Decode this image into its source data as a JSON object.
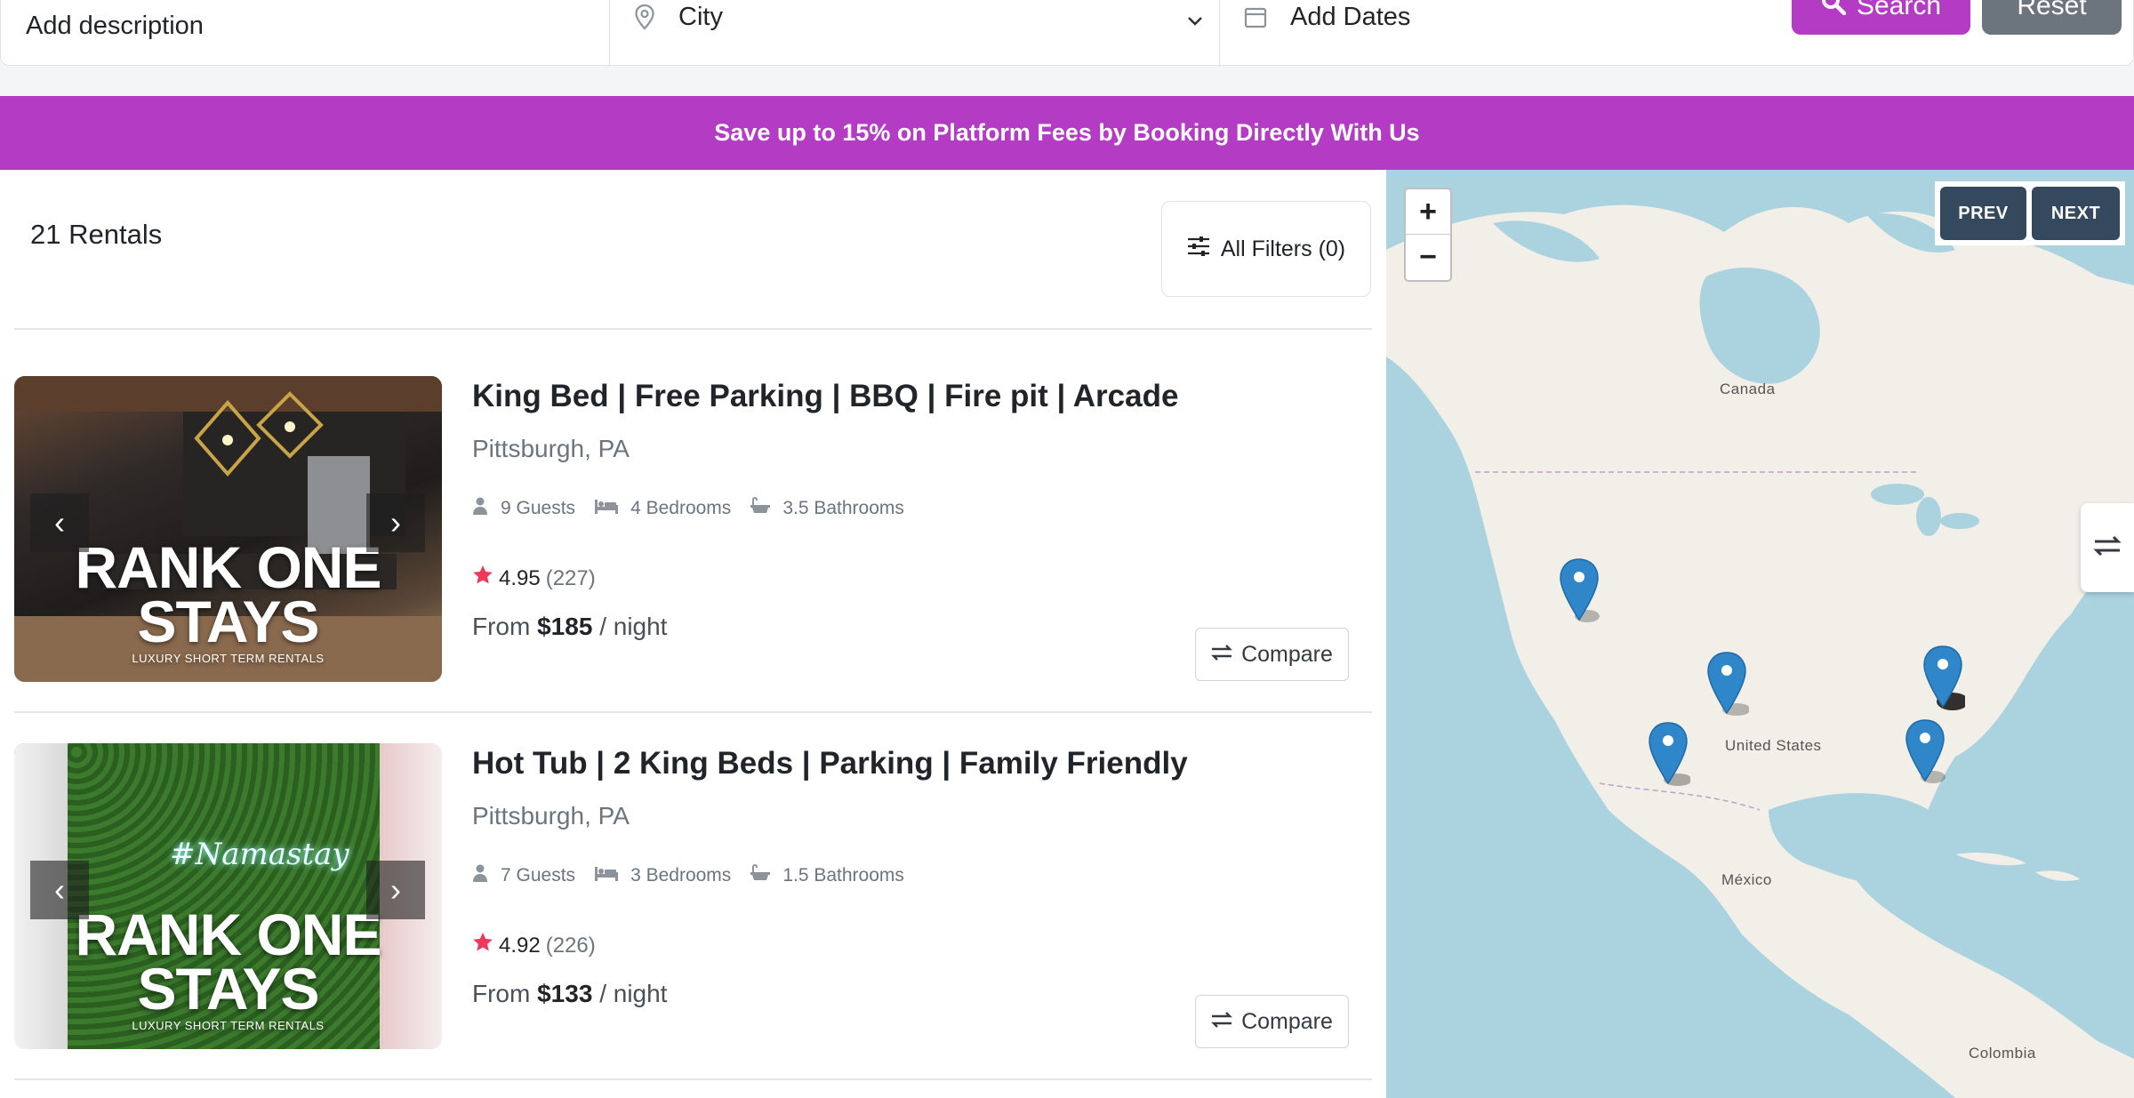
{
  "search": {
    "description_placeholder": "Add description",
    "city_placeholder": "City",
    "dates_placeholder": "Add Dates",
    "search_label": "Search",
    "reset_label": "Reset"
  },
  "promo": {
    "text": "Save up to 15% on Platform Fees by Booking Directly With Us",
    "color": "#b43cc4"
  },
  "results": {
    "count_label": "21 Rentals",
    "filters_label": "All Filters (0)"
  },
  "listings": [
    {
      "title": "King Bed | Free Parking | BBQ | Fire pit | Arcade",
      "location": "Pittsburgh, PA",
      "guests": "9",
      "guests_label": "Guests",
      "bedrooms": "4",
      "bedrooms_label": "Bedrooms",
      "bathrooms": "3.5",
      "bathrooms_label": "Bathrooms",
      "rating": "4.95",
      "reviews": "(227)",
      "price_prefix": "From",
      "price": "$185",
      "price_suffix": "/ night",
      "compare_label": "Compare",
      "photo_brand_line1": "RANK ONE",
      "photo_brand_line2": "STAYS",
      "photo_brand_tagline": "LUXURY SHORT TERM RENTALS",
      "prev_arrow": "‹",
      "next_arrow": "›"
    },
    {
      "title": "Hot Tub | 2 King Beds | Parking | Family Friendly",
      "location": "Pittsburgh, PA",
      "guests": "7",
      "guests_label": "Guests",
      "bedrooms": "3",
      "bedrooms_label": "Bedrooms",
      "bathrooms": "1.5",
      "bathrooms_label": "Bathrooms",
      "rating": "4.92",
      "reviews": "(226)",
      "price_prefix": "From",
      "price": "$133",
      "price_suffix": "/ night",
      "compare_label": "Compare",
      "photo_neon": "#Namastay",
      "photo_brand_line1": "RANK ONE",
      "photo_brand_line2": "STAYS",
      "photo_brand_tagline": "LUXURY SHORT TERM RENTALS",
      "prev_arrow": "‹",
      "next_arrow": "›"
    }
  ],
  "map": {
    "zoom_in": "+",
    "zoom_out": "−",
    "prev_label": "PREV",
    "next_label": "NEXT",
    "labels": {
      "canada": "Canada",
      "united_states": "United States",
      "mexico": "México",
      "colombia": "Colombia"
    },
    "toggle_icon": "swap-arrows-icon"
  },
  "colors": {
    "accent": "#b43cc4",
    "reset_gray": "#6c757d",
    "map_button": "#34495e",
    "star": "#f0385b",
    "pin": "#2f86c9",
    "water": "#aad3df",
    "land": "#f2efe9"
  }
}
